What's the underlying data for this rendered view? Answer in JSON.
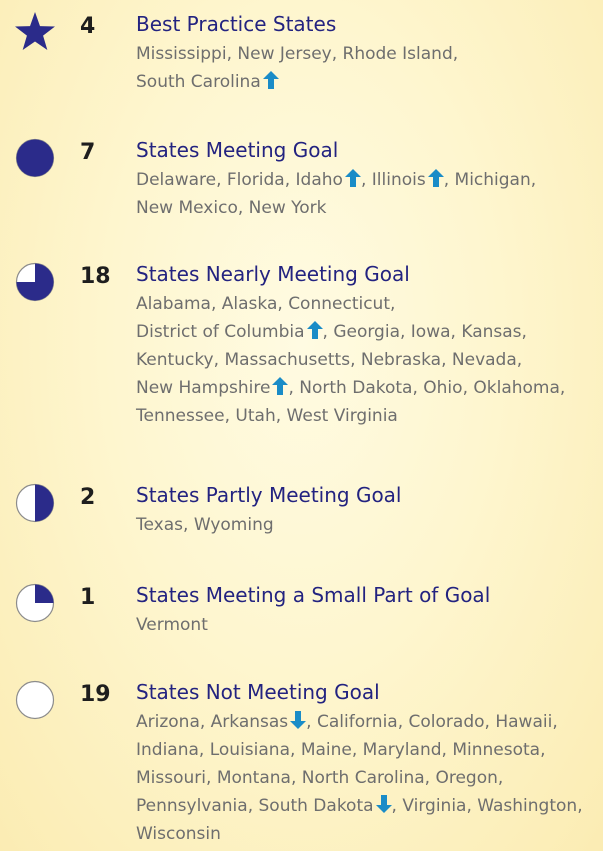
{
  "colors": {
    "icon_fill": "#2b2b8a",
    "title": "#232380",
    "arrow": "#1a8cc7",
    "text": "#6e6e6e"
  },
  "groups": [
    {
      "icon": "star-icon",
      "count": "4",
      "title": "Best Practice States",
      "states": [
        {
          "name": "Mississippi"
        },
        {
          "name": "New Jersey"
        },
        {
          "name": "Rhode Island"
        },
        {
          "name": "South Carolina",
          "arrow": "up"
        }
      ]
    },
    {
      "icon": "full-circle-icon",
      "fill": 1.0,
      "count": "7",
      "title": "States Meeting Goal",
      "states": [
        {
          "name": "Delaware"
        },
        {
          "name": "Florida"
        },
        {
          "name": "Idaho",
          "arrow": "up"
        },
        {
          "name": "Illinois",
          "arrow": "up"
        },
        {
          "name": "Michigan"
        },
        {
          "name": "New Mexico"
        },
        {
          "name": "New York"
        }
      ]
    },
    {
      "icon": "three-quarter-circle-icon",
      "fill": 0.75,
      "count": "18",
      "title": "States Nearly Meeting Goal",
      "states": [
        {
          "name": "Alabama"
        },
        {
          "name": "Alaska"
        },
        {
          "name": "Connecticut"
        },
        {
          "name": "District of Columbia",
          "arrow": "up"
        },
        {
          "name": "Georgia"
        },
        {
          "name": "Iowa"
        },
        {
          "name": "Kansas"
        },
        {
          "name": "Kentucky"
        },
        {
          "name": "Massachusetts"
        },
        {
          "name": "Nebraska"
        },
        {
          "name": "Nevada"
        },
        {
          "name": "New Hampshire",
          "arrow": "up"
        },
        {
          "name": "North Dakota"
        },
        {
          "name": "Ohio"
        },
        {
          "name": "Oklahoma"
        },
        {
          "name": "Tennessee"
        },
        {
          "name": "Utah"
        },
        {
          "name": "West Virginia"
        }
      ]
    },
    {
      "icon": "half-circle-icon",
      "fill": 0.5,
      "count": "2",
      "title": "States Partly Meeting Goal",
      "states": [
        {
          "name": "Texas"
        },
        {
          "name": "Wyoming"
        }
      ]
    },
    {
      "icon": "quarter-circle-icon",
      "fill": 0.25,
      "count": "1",
      "title": "States Meeting a Small Part of Goal",
      "states": [
        {
          "name": "Vermont"
        }
      ]
    },
    {
      "icon": "empty-circle-icon",
      "fill": 0.0,
      "count": "19",
      "title": "States Not Meeting Goal",
      "states": [
        {
          "name": "Arizona"
        },
        {
          "name": "Arkansas",
          "arrow": "down"
        },
        {
          "name": "California"
        },
        {
          "name": "Colorado"
        },
        {
          "name": "Hawaii"
        },
        {
          "name": "Indiana"
        },
        {
          "name": "Louisiana"
        },
        {
          "name": "Maine"
        },
        {
          "name": "Maryland"
        },
        {
          "name": "Minnesota"
        },
        {
          "name": "Missouri"
        },
        {
          "name": "Montana"
        },
        {
          "name": "North Carolina"
        },
        {
          "name": "Oregon"
        },
        {
          "name": "Pennsylvania"
        },
        {
          "name": "South Dakota",
          "arrow": "down"
        },
        {
          "name": "Virginia"
        },
        {
          "name": "Washington"
        },
        {
          "name": "Wisconsin"
        }
      ]
    }
  ]
}
